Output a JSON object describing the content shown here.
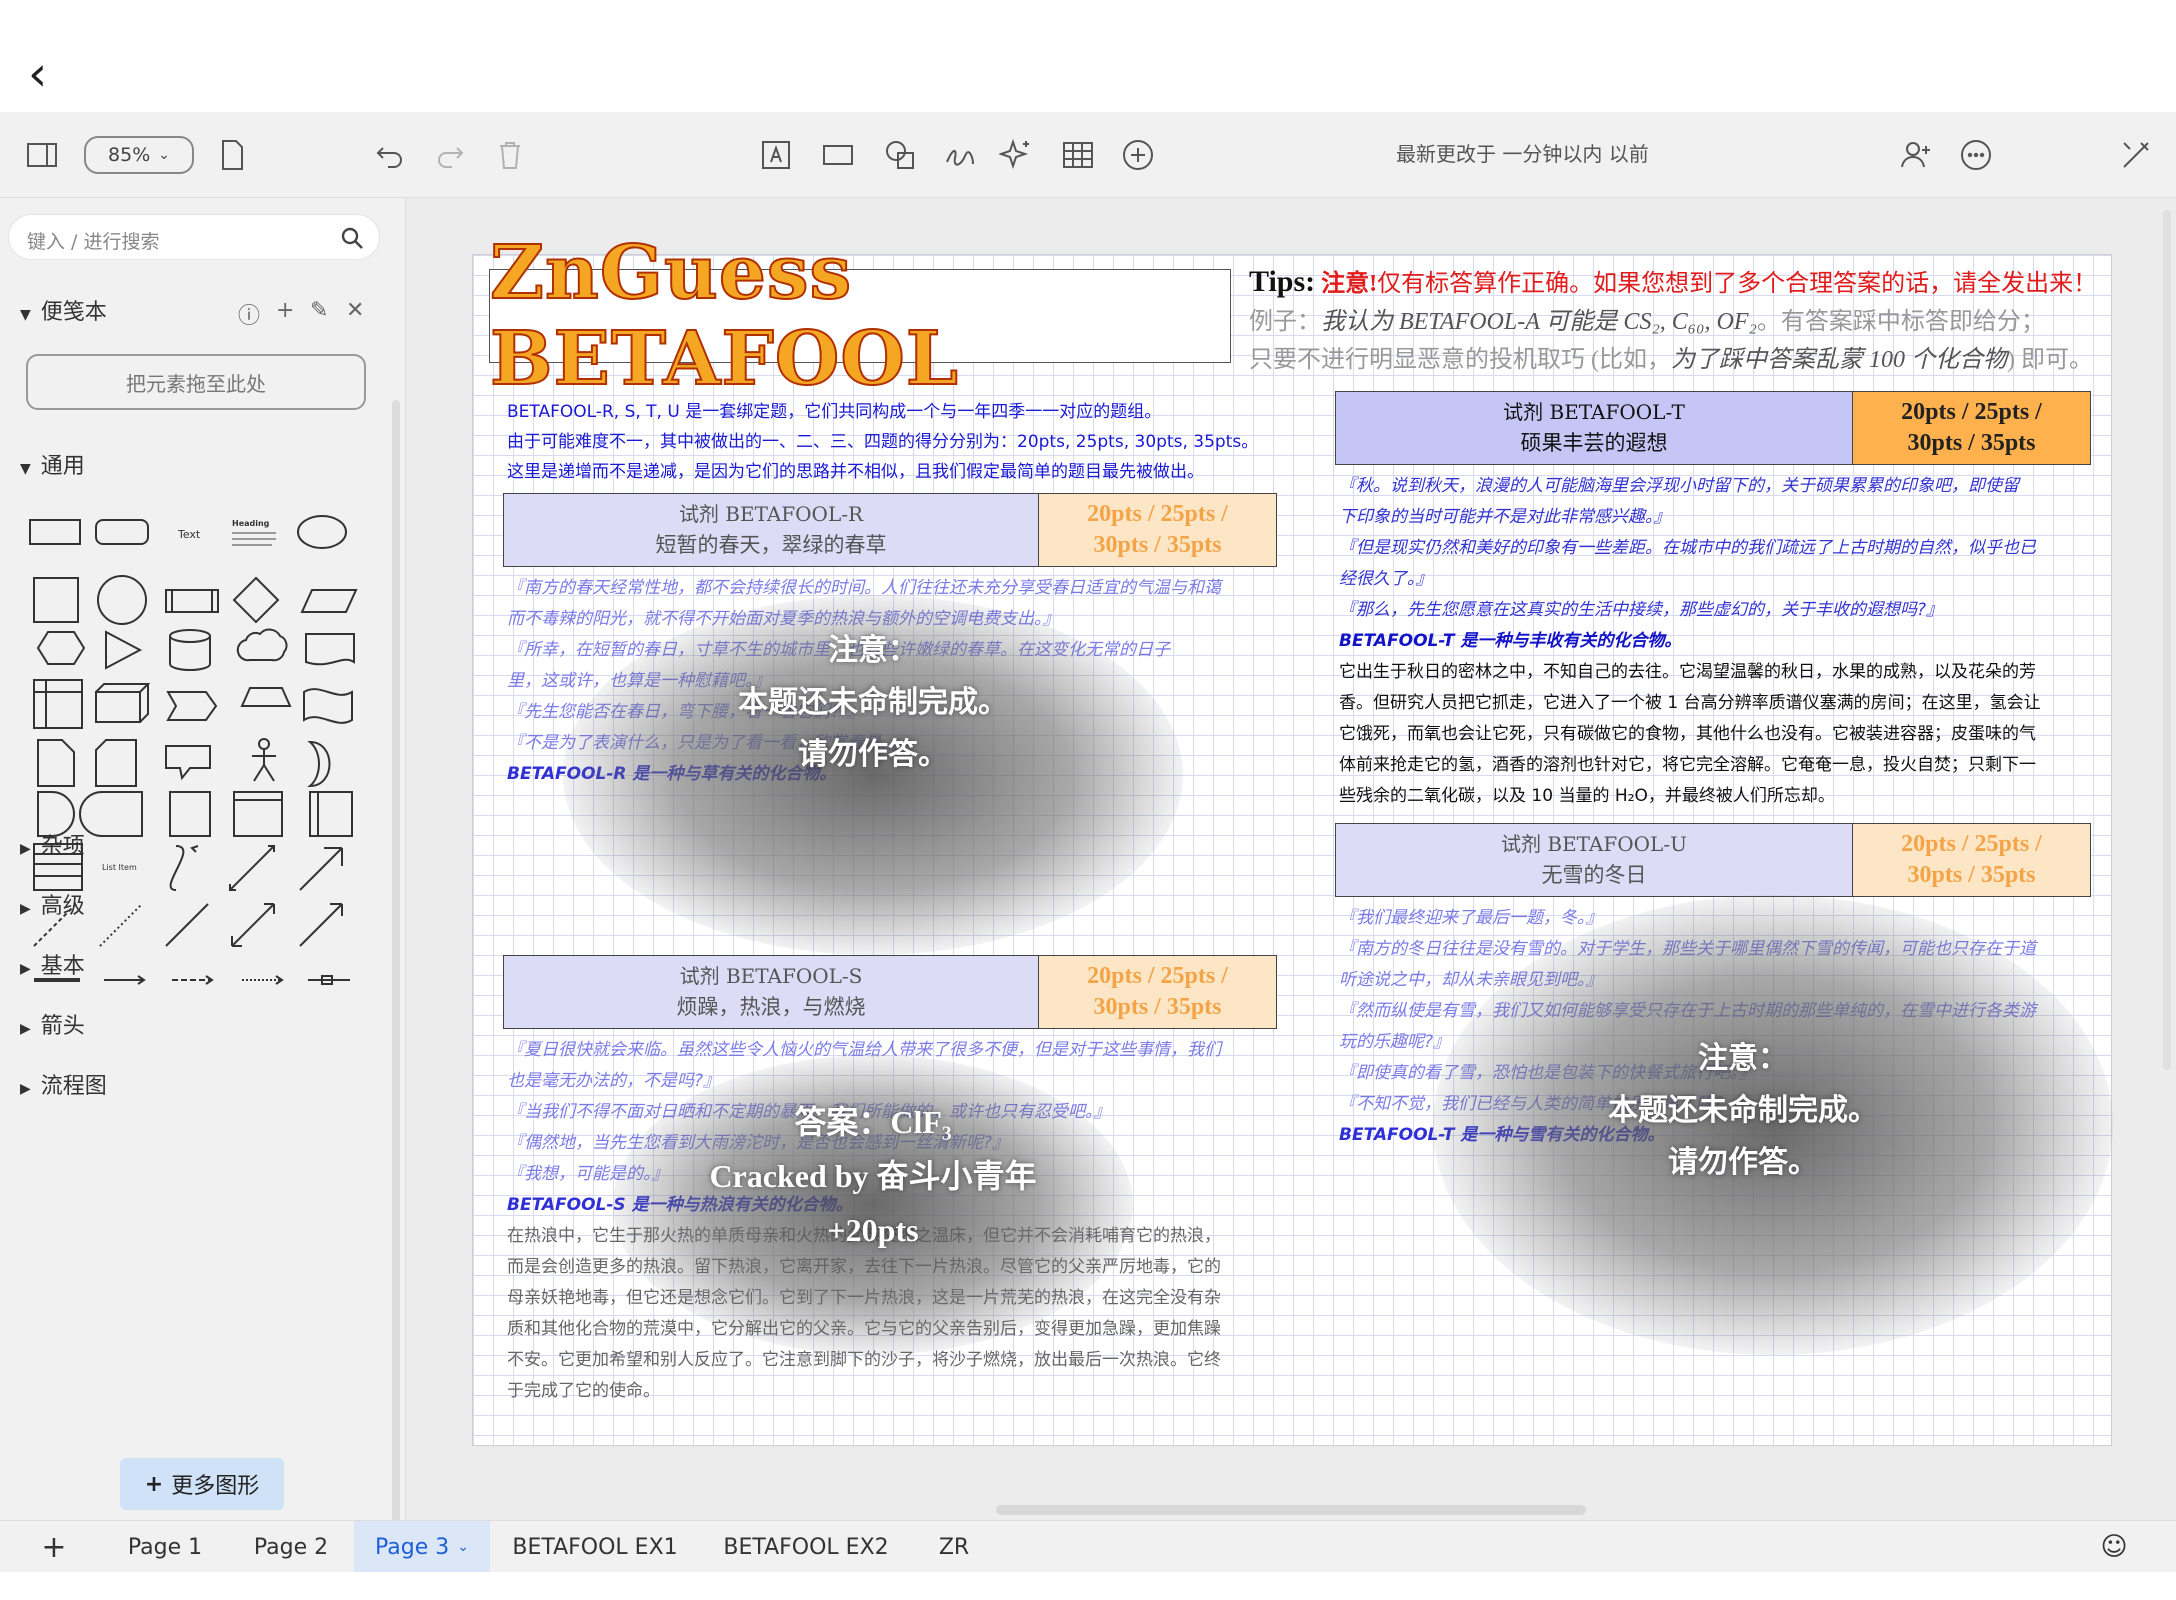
{
  "app": {
    "zoom": "85%",
    "last_modified": "最新更改于 一分钟以内 以前"
  },
  "sidebar": {
    "search_placeholder": "键入 / 进行搜索",
    "scratchpad_label": "便笺本",
    "drop_hint": "把元素拖至此处",
    "general_label": "通用",
    "text_shape": "Text",
    "heading_shape": "Heading",
    "list_item_shape": "List Item",
    "sections": [
      "杂项",
      "高级",
      "基本",
      "箭头",
      "流程图"
    ],
    "more_shapes": "更多图形"
  },
  "tabs": {
    "add": "+",
    "items": [
      "Page 1",
      "Page 2",
      "Page 3",
      "BETAFOOL EX1",
      "BETAFOOL EX2",
      "ZR"
    ],
    "active": "Page 3"
  },
  "doc": {
    "logo": "ZnGuess BETAFOOL",
    "tips": {
      "title": "Tips:",
      "notice_red": "注意!",
      "notice_text": "仅有标答算作正确。如果您想到了多个合理答案的话，请全发出来！",
      "example_prefix": "例子：",
      "example_italic": "我认为 BETAFOOL-A 可能是 CS₂, C₆₀, OF₂",
      "example_suffix": "。有答案踩中标答即给分；",
      "line3_prefix": "只要不进行明显恶意的投机取巧 (比如，",
      "line3_italic": "为了踩中答案乱蒙 100 个化合物",
      "line3_suffix": ") 即可。"
    },
    "intro": [
      "BETAFOOL-R, S, T, U 是一套绑定题，它们共同构成一个与一年四季一一对应的题组。",
      "由于可能难度不一，其中被做出的一、二、三、四题的得分分别为：20pts, 25pts, 30pts, 35pts。",
      "这里是递增而不是递减，是因为它们的思路并不相似，且我们假定最简单的题目最先被做出。"
    ],
    "score_line1": "20pts / 25pts /",
    "score_line2": "30pts / 35pts",
    "r": {
      "title": "试剂 BETAFOOL-R",
      "subtitle": "短暂的春天，翠绿的春草",
      "lines": [
        "『南方的春天经常性地，都不会持续很长的时间。人们往往还未充分享受春日适宜的气温与和蔼",
        "而不毒辣的阳光，就不得不开始面对夏季的热浪与额外的空调电费支出。』",
        "『所幸，在短暂的春日，寸草不生的城市里，也有些许嫩绿的春草。在这变化无常的日子",
        "里，这或许，也算是一种慰藉吧。』",
        "『先生您能否在春日，弯下腰，看一看它们？』",
        "『不是为了表演什么，只是为了看一看，欣赏春景。』"
      ],
      "final": "BETAFOOL-R 是一种与草有关的化合物。",
      "notice": [
        "注意：",
        "本题还未命制完成。",
        "请勿作答。"
      ]
    },
    "s": {
      "title": "试剂 BETAFOOL-S",
      "subtitle": "烦躁，热浪，与燃烧",
      "lines": [
        "『夏日很快就会来临。虽然这些令人恼火的气温给人带来了很多不便，但是对于这些事情，我们",
        "也是毫无办法的，不是吗?』",
        "『当我们不得不面对日晒和不定期的暴雨，我们所能做的，或许也只有忍受吧。』",
        "『偶然地，当先生您看到大雨滂沱时，是否也会感到一丝清新呢?』",
        "『我想，可能是的。』"
      ],
      "final": "BETAFOOL-S 是一种与热浪有关的化合物。",
      "body": [
        "在热浪中，它生于那火热的单质母亲和火热的父亲交织之温床，但它并不会消耗哺育它的热浪，",
        "而是会创造更多的热浪。留下热浪，它离开家，去往下一片热浪。尽管它的父亲严厉地毒，它的",
        "母亲妖艳地毒，但它还是想念它们。它到了下一片热浪，这是一片荒芜的热浪，在这完全没有杂",
        "质和其他化合物的荒漠中，它分解出它的父亲。它与它的父亲告别后，变得更加急躁，更加焦躁",
        "不安。它更加希望和别人反应了。它注意到脚下的沙子，将沙子燃烧，放出最后一次热浪。它终",
        "于完成了它的使命。"
      ],
      "answer": [
        "答案：ClF₃",
        "Cracked by 奋斗小青年",
        "+20pts"
      ]
    },
    "t": {
      "title": "试剂 BETAFOOL-T",
      "subtitle": "硕果丰芸的遐想",
      "lines": [
        "『秋。说到秋天，浪漫的人可能脑海里会浮现小时留下的，关于硕果累累的印象吧，即使留",
        "下印象的当时可能并不是对此非常感兴趣。』",
        "『但是现实仍然和美好的印象有一些差距。在城市中的我们疏远了上古时期的自然，似乎也已",
        "经很久了。』",
        "『那么，先生您愿意在这真实的生活中接续，那些虚幻的，关于丰收的遐想吗?』"
      ],
      "final": "BETAFOOL-T 是一种与丰收有关的化合物。",
      "body": [
        "它出生于秋日的密林之中，不知自己的去往。它渴望温馨的秋日，水果的成熟，以及花朵的芳",
        "香。但研究人员把它抓走，它进入了一个被 1 台高分辨率质谱仪塞满的房间；在这里，氢会让",
        "它饿死，而氧也会让它死，只有碳做它的食物，其他什么也没有。它被装进容器；皮蛋味的气",
        "体前来抢走它的氢，酒香的溶剂也针对它，将它完全溶解。它奄奄一息，投火自焚；只剩下一",
        "些残余的二氧化碳，以及 10 当量的 H₂O，并最终被人们所忘却。"
      ]
    },
    "u": {
      "title": "试剂 BETAFOOL-U",
      "subtitle": "无雪的冬日",
      "lines": [
        "『我们最终迎来了最后一题，冬。』",
        "『南方的冬日往往是没有雪的。对于学生，那些关于哪里偶然下雪的传闻，可能也只存在于道",
        "听途说之中，却从未亲眼见到吧。』",
        "『然而纵使是有雪，我们又如何能够享受只存在于上古时期的那些单纯的，在雪中进行各类游",
        "玩的乐趣呢?』",
        "『即使真的看了雪，恐怕也是包装下的快餐式旅行吧。』",
        "『不知不觉，我们已经与人类的简单快乐分离了吗？』"
      ],
      "final": "BETAFOOL-T 是一种与雪有关的化合物。",
      "notice": [
        "注意：",
        "本题还未命制完成。",
        "请勿作答。"
      ]
    }
  }
}
